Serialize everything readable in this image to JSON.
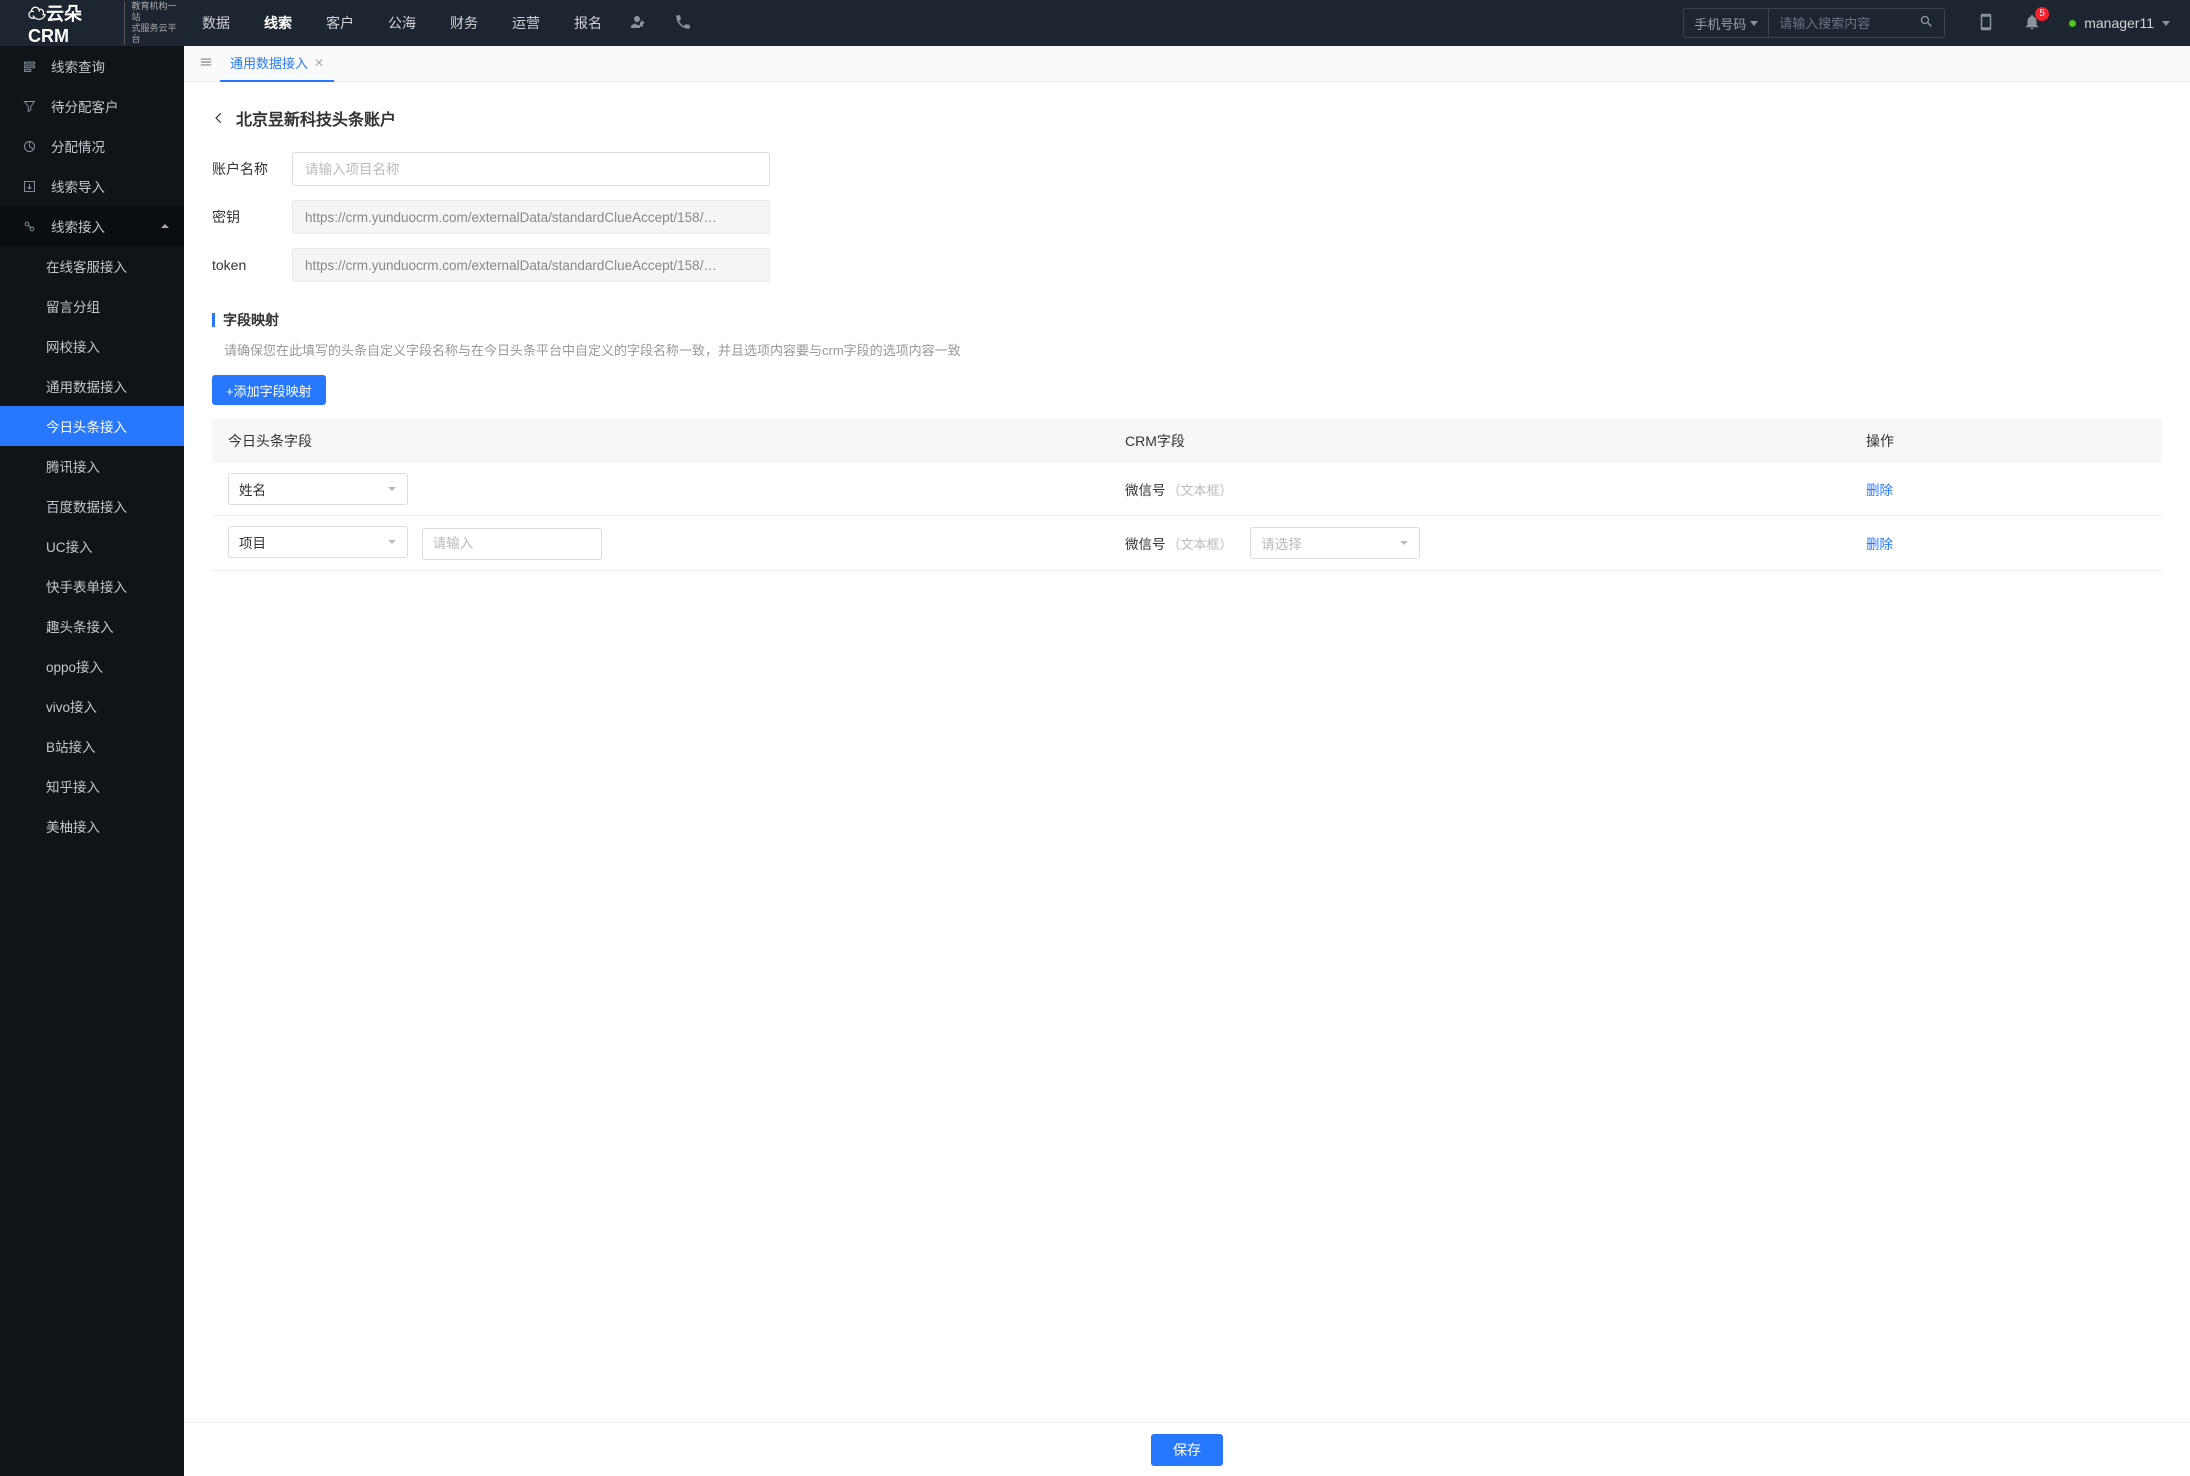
{
  "brand": {
    "name": "云朵CRM",
    "tagline1": "教育机构一站",
    "tagline2": "式服务云平台"
  },
  "nav": [
    {
      "label": "数据"
    },
    {
      "label": "线索",
      "active": true
    },
    {
      "label": "客户"
    },
    {
      "label": "公海"
    },
    {
      "label": "财务"
    },
    {
      "label": "运营"
    },
    {
      "label": "报名"
    }
  ],
  "search": {
    "type": "手机号码",
    "placeholder": "请输入搜索内容"
  },
  "notification_count": "5",
  "username": "manager11",
  "sidebar": {
    "items": [
      {
        "label": "线索查询",
        "icon": "list"
      },
      {
        "label": "待分配客户",
        "icon": "filter"
      },
      {
        "label": "分配情况",
        "icon": "pie"
      },
      {
        "label": "线索导入",
        "icon": "export"
      },
      {
        "label": "线索接入",
        "icon": "plug",
        "expanded": true,
        "children": [
          {
            "label": "在线客服接入"
          },
          {
            "label": "留言分组"
          },
          {
            "label": "网校接入"
          },
          {
            "label": "通用数据接入"
          },
          {
            "label": "今日头条接入",
            "active": true
          },
          {
            "label": "腾讯接入"
          },
          {
            "label": "百度数据接入"
          },
          {
            "label": "UC接入"
          },
          {
            "label": "快手表单接入"
          },
          {
            "label": "趣头条接入"
          },
          {
            "label": "oppo接入"
          },
          {
            "label": "vivo接入"
          },
          {
            "label": "B站接入"
          },
          {
            "label": "知乎接入"
          },
          {
            "label": "美柚接入"
          }
        ]
      }
    ]
  },
  "tabs": [
    {
      "label": "通用数据接入"
    }
  ],
  "page": {
    "title": "北京昱新科技头条账户",
    "form": {
      "name_label": "账户名称",
      "name_placeholder": "请输入项目名称",
      "secret_label": "密钥",
      "secret_value": "https://crm.yunduocrm.com/externalData/standardClueAccept/158/…",
      "token_label": "token",
      "token_value": "https://crm.yunduocrm.com/externalData/standardClueAccept/158/…"
    },
    "mapping": {
      "title": "字段映射",
      "desc": "请确保您在此填写的头条自定义字段名称与在今日头条平台中自定义的字段名称一致，并且选项内容要与crm字段的选项内容一致",
      "add_btn": "+添加字段映射",
      "columns": {
        "c1": "今日头条字段",
        "c2": "CRM字段",
        "c3": "操作"
      },
      "rows": [
        {
          "field1": "姓名",
          "crm": "微信号",
          "crm_hint": "（文本框）",
          "action": "删除"
        },
        {
          "field1": "项目",
          "extra_placeholder": "请输入",
          "crm": "微信号",
          "crm_hint": "（文本框）",
          "select_placeholder": "请选择",
          "action": "删除"
        }
      ]
    },
    "save": "保存"
  }
}
